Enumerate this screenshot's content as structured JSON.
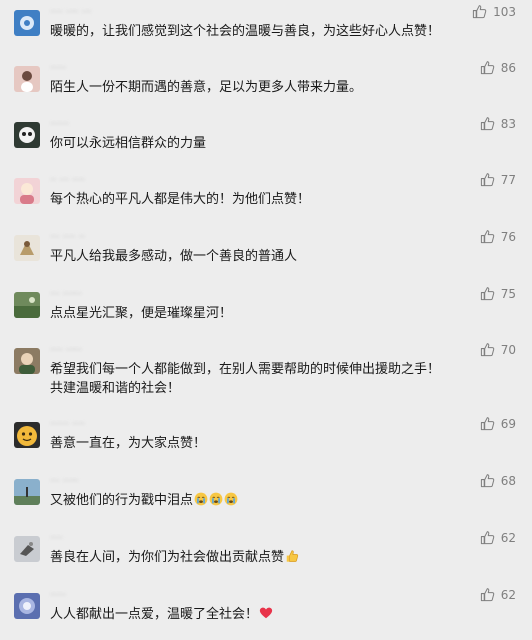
{
  "comments": [
    {
      "name": "···· ···· ···",
      "text": "暖暖的，让我们感觉到这个社会的温暖与善良，为这些好心人点赞！",
      "likes": "103",
      "avatar_color": "#3f7fc4"
    },
    {
      "name": "·····",
      "text": "陌生人一份不期而遇的善意，足以为更多人带来力量。",
      "likes": "86",
      "avatar_color": "#e6c8c2"
    },
    {
      "name": "······",
      "text": "你可以永远相信群众的力量",
      "likes": "83",
      "avatar_color": "#2f3a33"
    },
    {
      "name": "·· ··· ····",
      "text": "每个热心的平凡人都是伟大的！为他们点赞！",
      "likes": "77",
      "avatar_color": "#f2d3d6"
    },
    {
      "name": "··· ···· ··",
      "text": "平凡人给我最多感动，做一个善良的普通人",
      "likes": "76",
      "avatar_color": "#e9e4da"
    },
    {
      "name": "··· ······",
      "text": "点点星光汇聚，便是璀璨星河！",
      "likes": "75",
      "avatar_color": "#6f8a5c"
    },
    {
      "name": "···· ·····",
      "text": "希望我们每一个人都能做到，在别人需要帮助的时候伸出援助之手！共建温暖和谐的社会！",
      "likes": "70",
      "avatar_color": "#8c7b63"
    },
    {
      "name": "······ ····",
      "text": "善意一直在，为大家点赞！",
      "likes": "69",
      "avatar_color": "#f2b93b"
    },
    {
      "name": "··· ·····",
      "text": "又被他们的行为戳中泪点",
      "likes": "68",
      "avatar_color": "#8ab0cc"
    },
    {
      "name": "····",
      "text": "善良在人间，为你们为社会做出贡献点赞",
      "likes": "62",
      "avatar_color": "#c9ccd1"
    },
    {
      "name": "·····",
      "text": "人人都献出一点爱，温暖了全社会！",
      "likes": "62",
      "avatar_color": "#5b6fb0"
    }
  ],
  "icons": {
    "like": "thumbs-up-icon",
    "crying": "crying-face-emoji",
    "thumbs": "thumbs-up-emoji",
    "heart": "red-heart-emoji"
  },
  "colors": {
    "background": "#ededed",
    "text": "#191919",
    "secondary": "#7f7f7f",
    "heart": "#e8334a",
    "emoji_yellow": "#f7c744"
  }
}
